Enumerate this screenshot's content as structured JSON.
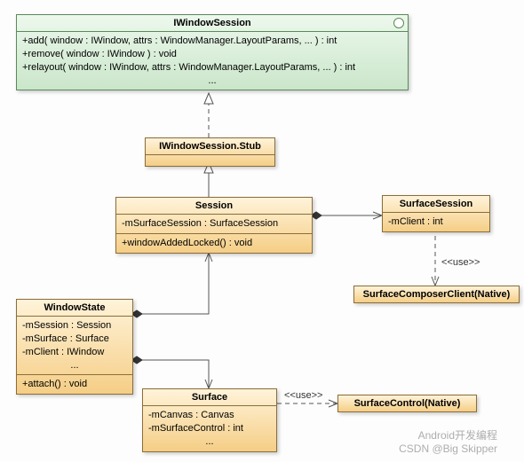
{
  "classes": {
    "IWindowSession": {
      "title": "IWindowSession",
      "ops": [
        "+add( window : IWindow, attrs : WindowManager.LayoutParams, ... ) : int",
        "+remove( window : IWindow ) : void",
        "+relayout( window : IWindow, attrs : WindowManager.LayoutParams, ... ) : int"
      ],
      "ell": "..."
    },
    "IWindowSessionStub": {
      "title": "IWindowSession.Stub"
    },
    "Session": {
      "title": "Session",
      "attrs": "-mSurfaceSession : SurfaceSession",
      "ops": "+windowAddedLocked() : void"
    },
    "SurfaceSession": {
      "title": "SurfaceSession",
      "attrs": "-mClient : int"
    },
    "SurfaceComposerClient": {
      "title": "SurfaceComposerClient(Native)"
    },
    "WindowState": {
      "title": "WindowState",
      "attrs": [
        "-mSession : Session",
        "-mSurface : Surface",
        "-mClient : IWindow"
      ],
      "ell": "...",
      "ops": "+attach() : void"
    },
    "Surface": {
      "title": "Surface",
      "attrs": [
        "-mCanvas : Canvas",
        "-mSurfaceControl : int"
      ],
      "ell": "..."
    },
    "SurfaceControl": {
      "title": "SurfaceControl(Native)"
    }
  },
  "labels": {
    "use1": "<<use>>",
    "use2": "<<use>>"
  },
  "watermark": {
    "line1": "Android开发编程",
    "line2": "CSDN @Big Skipper"
  }
}
